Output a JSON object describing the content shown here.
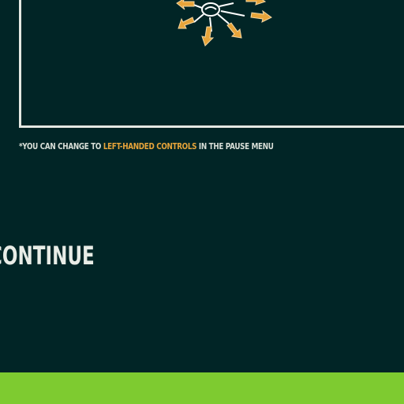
{
  "colors": {
    "background": "#012526",
    "frame": "#e4e8e2",
    "accent": "#e7a43a",
    "text": "#d9dfd8",
    "bottom_bar": "#7ecb30"
  },
  "illustration": {
    "icon": "swipe-direction-arrows-icon"
  },
  "footnote": {
    "prefix": "*YOU CAN CHANGE TO ",
    "highlight": "LEFT-HANDED CONTROLS",
    "suffix": " IN THE PAUSE MENU"
  },
  "continue_label": "CONTINUE"
}
